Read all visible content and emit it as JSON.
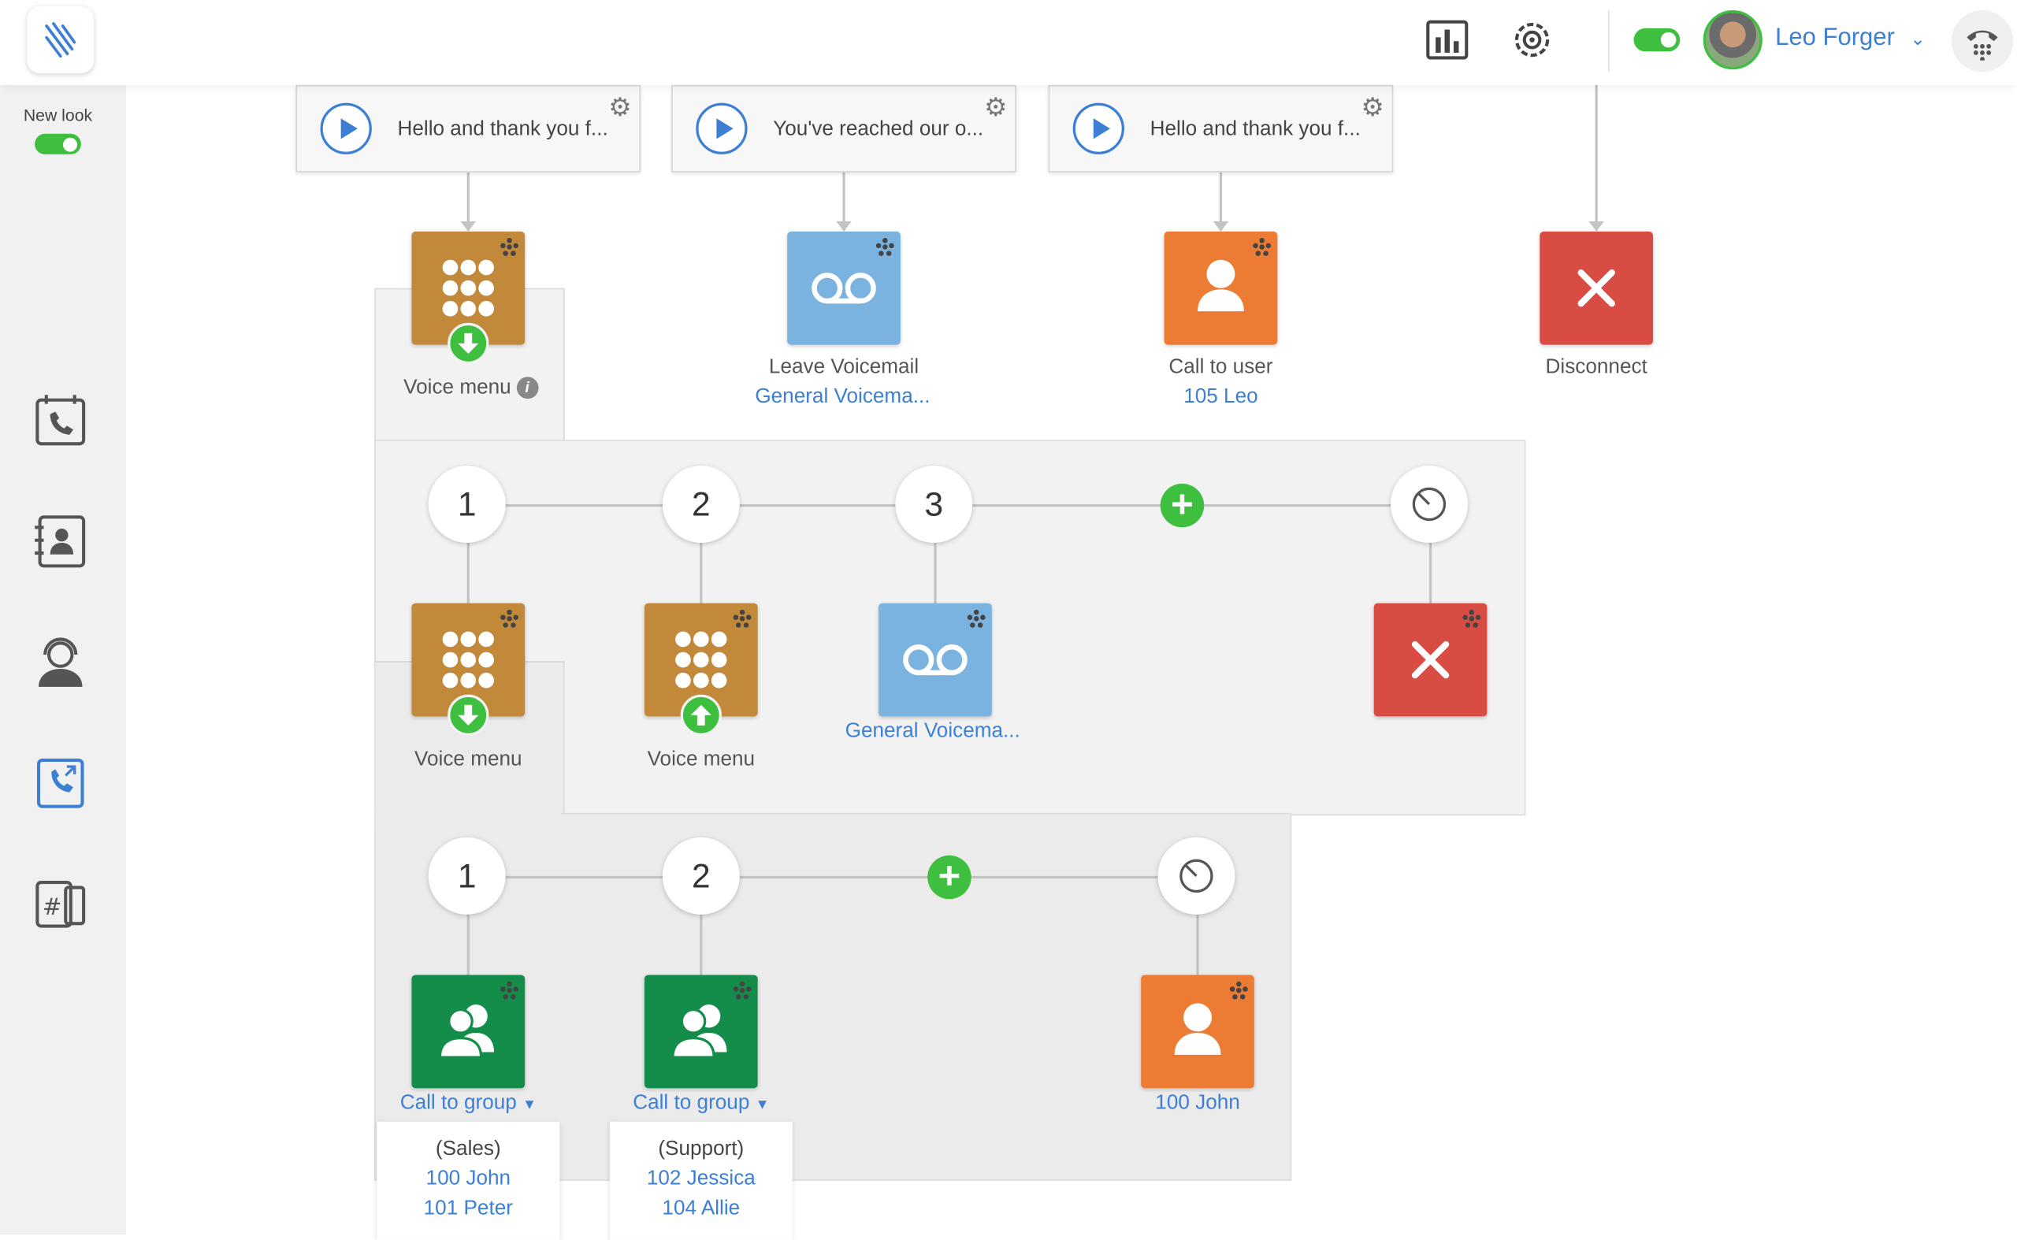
{
  "header": {
    "user_name": "Leo Forger",
    "icons": [
      "logo-icon",
      "stats-icon",
      "settings-icon",
      "dialpad-icon"
    ]
  },
  "sidebar": {
    "new_look_label": "New look",
    "items": [
      "call-history-icon",
      "contacts-icon",
      "agent-icon",
      "call-flow-icon",
      "numbers-icon"
    ]
  },
  "prompts": [
    {
      "text": "Hello and thank you f..."
    },
    {
      "text": "You've reached our o..."
    },
    {
      "text": "Hello and thank you f..."
    }
  ],
  "top_actions": {
    "voice_menu": "Voice menu",
    "leave_voicemail": "Leave Voicemail",
    "voicemail_target": "General Voicema...",
    "call_to_user": "Call to user",
    "user_target": "105 Leo",
    "disconnect": "Disconnect"
  },
  "menu_level1": {
    "keys": [
      "1",
      "2",
      "3"
    ],
    "key1_label": "Voice menu",
    "key2_label": "Voice menu",
    "key3_link": "General Voicema..."
  },
  "menu_level2": {
    "keys": [
      "1",
      "2"
    ],
    "key1_link": "Call to group",
    "key2_link": "Call to group",
    "timeout_link": "100 John",
    "group_sales": {
      "name": "(Sales)",
      "members": [
        "100 John",
        "101 Peter"
      ]
    },
    "group_support": {
      "name": "(Support)",
      "members": [
        "102 Jessica",
        "104 Allie"
      ]
    }
  },
  "colors": {
    "accent_blue": "#3c7fd4",
    "green": "#3fbf3f",
    "voice_menu": "#c3893b",
    "voicemail": "#7ab3df",
    "user": "#ec7c34",
    "disconnect": "#d94c43",
    "group": "#148c4a"
  }
}
